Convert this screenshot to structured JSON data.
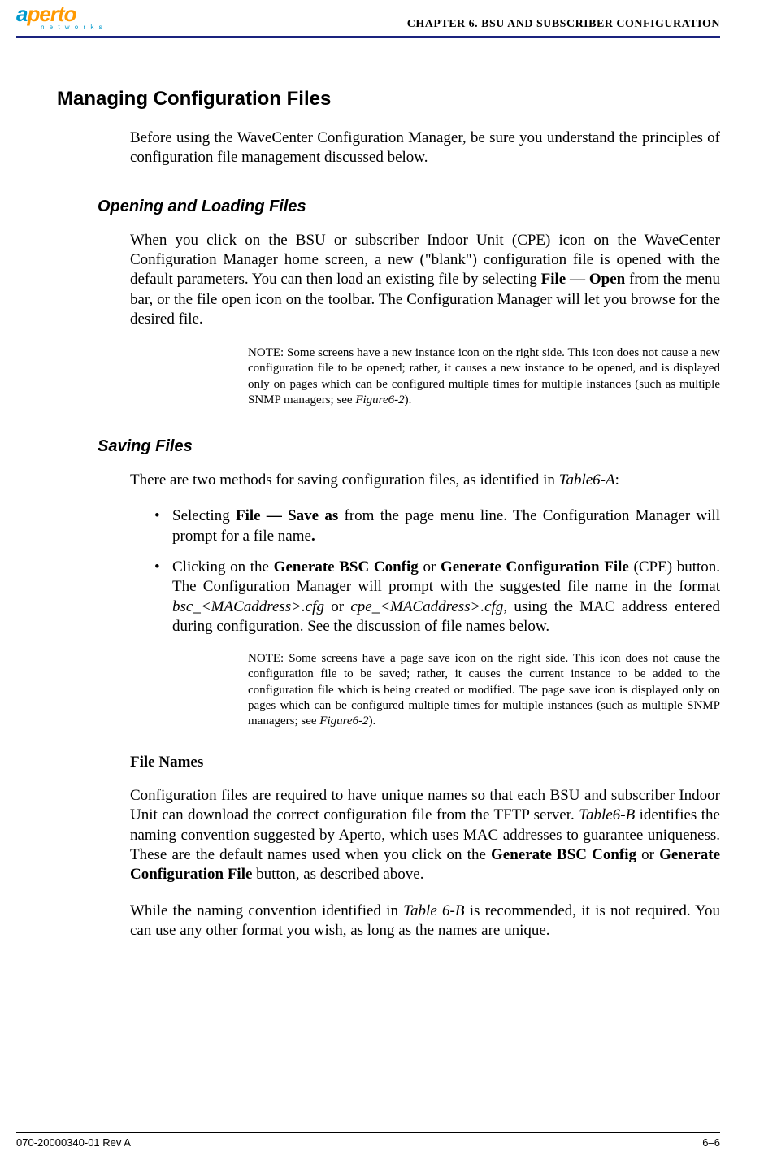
{
  "header": {
    "logo_main_a": "a",
    "logo_main_rest": "perto",
    "logo_sub": "n e t w o r k s",
    "chapter": "CHAPTER 6.   BSU AND SUBSCRIBER CONFIGURATION"
  },
  "h1": "Managing Configuration Files",
  "intro": "Before using the WaveCenter Configuration Manager, be sure you understand the principles of configuration file management discussed below.",
  "s1": {
    "h2": "Opening and Loading Files",
    "p1_a": "When you click on the BSU or subscriber Indoor Unit (CPE) icon on the WaveCenter Configuration Manager home screen, a new (\"blank\") configuration file is opened with the default parameters. You can then load an existing file by selecting ",
    "p1_b": "File — Open",
    "p1_c": " from the menu bar, or the file open icon on the toolbar. The Configuration Man­ager will let you browse for the desired file.",
    "note_a": "NOTE:  Some screens have a new instance icon on the right side. This icon does not cause a new configuration file to be opened; rather, it causes a new instance to be opened, and is displayed only on pages which can be configured multiple times for multiple instances (such as multiple SNMP managers; see ",
    "note_b": "Figure6-2",
    "note_c": ")."
  },
  "s2": {
    "h2": "Saving Files",
    "p1_a": "There are two methods for saving configuration files, as identified in ",
    "p1_b": "Table6-A",
    "p1_c": ":",
    "li1_a": "Selecting ",
    "li1_b": "File — Save as",
    "li1_c": " from the page menu line. The Configuration Manager will prompt for a file name",
    "li1_d": ".",
    "li2_a": "Clicking on the ",
    "li2_b": "Generate BSC Config",
    "li2_c": " or ",
    "li2_d": "Generate Configuration File",
    "li2_e": " (CPE) button. The Configuration Manager will prompt with the suggested file name in the format ",
    "li2_f": "bsc_<MACaddress>.cfg",
    "li2_g": " or ",
    "li2_h": "cpe_<MACaddress>.cfg",
    "li2_i": ", using the MAC address entered during configuration. See the discussion of file names below.",
    "note_a": "NOTE:  Some screens have a page save icon on the right side. This icon does not cause the configuration file to be saved; rather, it causes the current instance to be added to the configuration file which is being created or modified. The page save icon is displayed only on pages which can be configured multiple times for multiple instances (such as multiple SNMP managers; see ",
    "note_b": "Figure6-2",
    "note_c": ")."
  },
  "s3": {
    "h3": "File Names",
    "p1_a": "Configuration files are required to have unique names so that each BSU and sub­scriber Indoor Unit can download the correct configuration file from the TFTP server. ",
    "p1_b": "Table6-B",
    "p1_c": " identifies the naming convention suggested by Aperto, which uses MAC addresses to guarantee uniqueness. These are the default names used when you click on the ",
    "p1_d": "Generate BSC Config",
    "p1_e": " or ",
    "p1_f": "Generate Configuration File",
    "p1_g": " button, as described above.",
    "p2_a": "While the naming convention identified in ",
    "p2_b": "Table 6-B",
    "p2_c": " is recommended, it is not required. You can use any other format you wish, as long as the names are unique."
  },
  "footer": {
    "left": "070-20000340-01 Rev A",
    "right": "6–6"
  }
}
